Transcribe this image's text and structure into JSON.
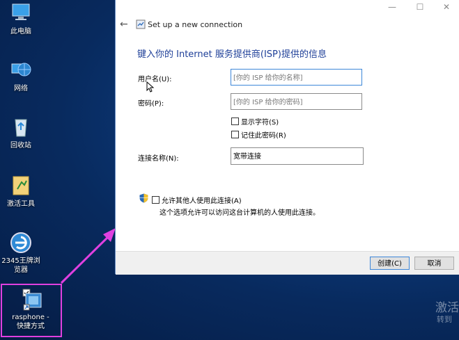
{
  "desktop": {
    "icons": [
      {
        "label": "此电脑"
      },
      {
        "label": "网络"
      },
      {
        "label": "回收站"
      },
      {
        "label": "激活工具"
      },
      {
        "label_line1": "2345王牌浏",
        "label_line2": "览器"
      },
      {
        "label_line1": "rasphone -",
        "label_line2": "快捷方式"
      }
    ],
    "watermark_line1": "激活",
    "watermark_line2": "转到"
  },
  "dialog": {
    "window_buttons": {
      "minimize": "—",
      "maximize": "☐",
      "close": "✕"
    },
    "header_title": "Set up a new connection",
    "heading": "键入你的 Internet 服务提供商(ISP)提供的信息",
    "fields": {
      "username": {
        "label": "用户名(U):",
        "placeholder": "[你的 ISP 给你的名称]"
      },
      "password": {
        "label": "密码(P):",
        "placeholder": "[你的 ISP 给你的密码]"
      },
      "connection_name": {
        "label": "连接名称(N):",
        "value": "宽带连接"
      }
    },
    "checkboxes": {
      "show_chars": "显示字符(S)",
      "remember_password": "记住此密码(R)",
      "allow_others": "允许其他人使用此连接(A)"
    },
    "note": "这个选项允许可以访问这台计算机的人使用此连接。",
    "buttons": {
      "create": "创建(C)",
      "cancel": "取消"
    }
  },
  "colors": {
    "accent": "#1e3f98",
    "highlight": "#e040e0"
  }
}
